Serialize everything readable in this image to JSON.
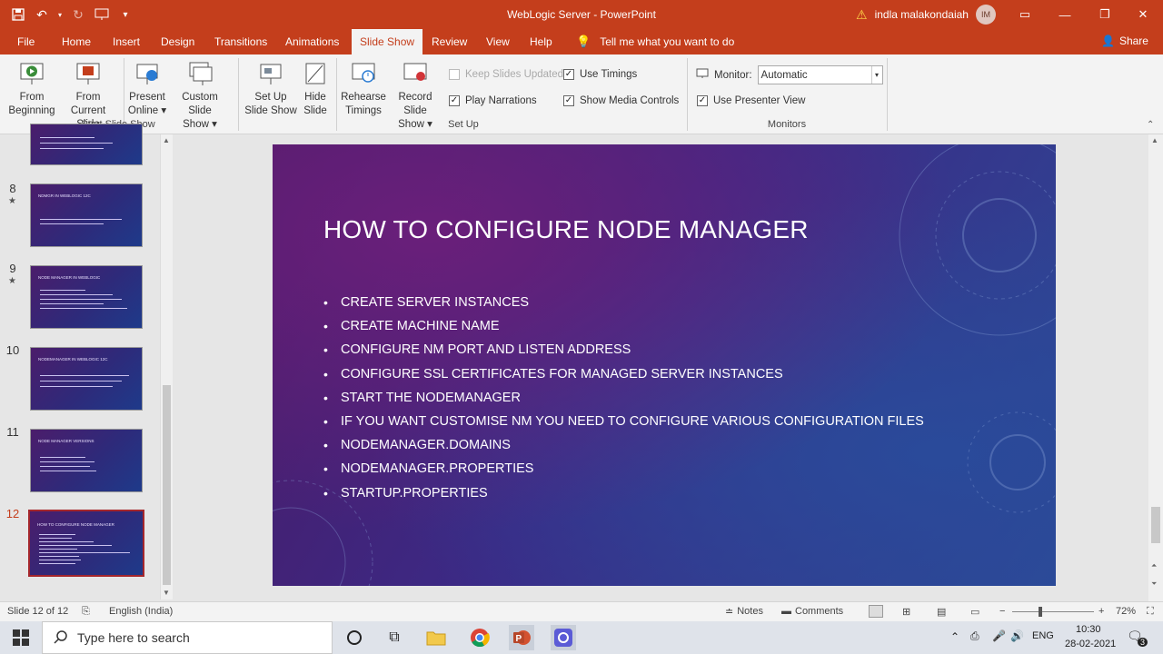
{
  "window": {
    "title": "WebLogic Server  -  PowerPoint",
    "user_name": "indla malakondaiah",
    "user_initials": "IM"
  },
  "tabs": [
    "File",
    "Home",
    "Insert",
    "Design",
    "Transitions",
    "Animations",
    "Slide Show",
    "Review",
    "View",
    "Help"
  ],
  "tell_me": "Tell me what you want to do",
  "share": "Share",
  "ribbon": {
    "start_group": {
      "label": "Start Slide Show",
      "buttons": [
        {
          "line1": "From",
          "line2": "Beginning"
        },
        {
          "line1": "From",
          "line2": "Current Slide"
        },
        {
          "line1": "Present",
          "line2": "Online ▾"
        },
        {
          "line1": "Custom Slide",
          "line2": "Show ▾"
        }
      ]
    },
    "setup_group": {
      "label": "Set Up",
      "buttons": [
        {
          "line1": "Set Up",
          "line2": "Slide Show"
        },
        {
          "line1": "Hide",
          "line2": "Slide"
        },
        {
          "line1": "Rehearse",
          "line2": "Timings"
        },
        {
          "line1": "Record Slide",
          "line2": "Show ▾"
        }
      ],
      "checks": [
        {
          "label": "Keep Slides Updated",
          "checked": false,
          "disabled": true
        },
        {
          "label": "Play Narrations",
          "checked": true,
          "disabled": false
        },
        {
          "label": "Use Timings",
          "checked": true,
          "disabled": false
        },
        {
          "label": "Show Media Controls",
          "checked": true,
          "disabled": false
        }
      ]
    },
    "monitors_group": {
      "label": "Monitors",
      "monitor_label": "Monitor:",
      "monitor_value": "Automatic",
      "presenter_view": "Use Presenter View"
    }
  },
  "thumbnails": [
    {
      "num": "8",
      "title": "NDMGR IN WEBLOGIC 12C"
    },
    {
      "num": "9",
      "title": "NODE MANAGER IN WEBLOGIC"
    },
    {
      "num": "10",
      "title": "NODEMANAGER IN WEBLOGIC 12C"
    },
    {
      "num": "11",
      "title": "NODE MANAGER VERSIONS"
    },
    {
      "num": "12",
      "title": "HOW TO CONFIGURE NODE MANAGER"
    }
  ],
  "slide": {
    "title": "HOW TO CONFIGURE NODE MANAGER",
    "bullets": [
      "CREATE SERVER INSTANCES",
      "CREATE MACHINE NAME",
      "CONFIGURE NM PORT AND LISTEN ADDRESS",
      "CONFIGURE SSL CERTIFICATES FOR MANAGED SERVER INSTANCES",
      "START THE NODEMANAGER",
      "IF YOU WANT CUSTOMISE NM YOU NEED TO CONFIGURE VARIOUS CONFIGURATION FILES",
      "NODEMANAGER.DOMAINS",
      "NODEMANAGER.PROPERTIES",
      "STARTUP.PROPERTIES"
    ]
  },
  "status": {
    "slide_info": "Slide 12 of 12",
    "language": "English (India)",
    "notes": "Notes",
    "comments": "Comments",
    "zoom": "72%"
  },
  "taskbar": {
    "search_placeholder": "Type here to search",
    "lang": "ENG",
    "time": "10:30",
    "date": "28-02-2021",
    "notif_count": "3"
  },
  "colors": {
    "accent": "#c43e1c",
    "selected_thumb_border": "#a4262c"
  }
}
